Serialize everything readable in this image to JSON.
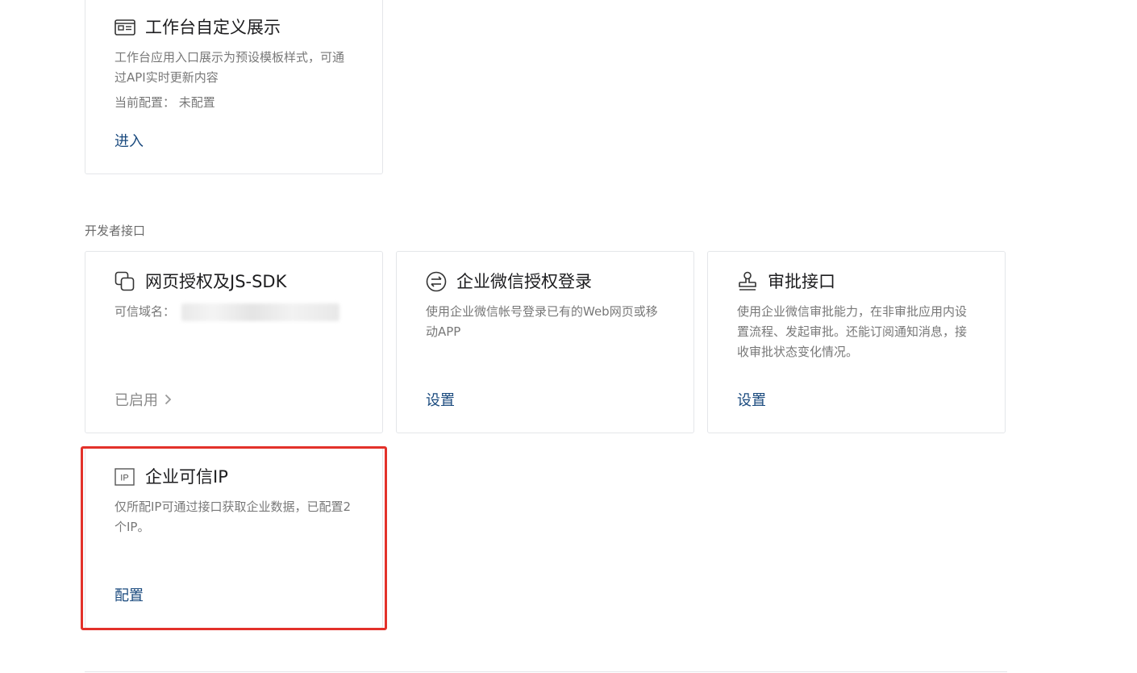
{
  "cards": {
    "workbench": {
      "title": "工作台自定义展示",
      "desc": "工作台应用入口展示为预设模板样式，可通过API实时更新内容",
      "meta_label": "当前配置：",
      "meta_value": "未配置",
      "action": "进入",
      "icon": "id-card-icon"
    },
    "web_auth": {
      "title": "网页授权及JS-SDK",
      "domain_label": "可信域名：",
      "action": "已启用",
      "icon": "overlap-squares-icon"
    },
    "wechat_login": {
      "title": "企业微信授权登录",
      "desc": "使用企业微信帐号登录已有的Web网页或移动APP",
      "action": "设置",
      "icon": "swap-arrows-icon"
    },
    "approval": {
      "title": "审批接口",
      "desc": "使用企业微信审批能力，在非审批应用内设置流程、发起审批。还能订阅通知消息，接收审批状态变化情况。",
      "action": "设置",
      "icon": "stamp-icon"
    },
    "trusted_ip": {
      "title": "企业可信IP",
      "desc": "仅所配IP可通过接口获取企业数据，已配置2个IP。",
      "action": "配置",
      "icon": "ip-badge-icon",
      "icon_text": "IP"
    }
  },
  "section": {
    "developer_api": "开发者接口"
  },
  "colors": {
    "link": "#1a4a7e",
    "muted_text": "#787878",
    "border": "#e4e6e9",
    "highlight": "#e3312a"
  }
}
